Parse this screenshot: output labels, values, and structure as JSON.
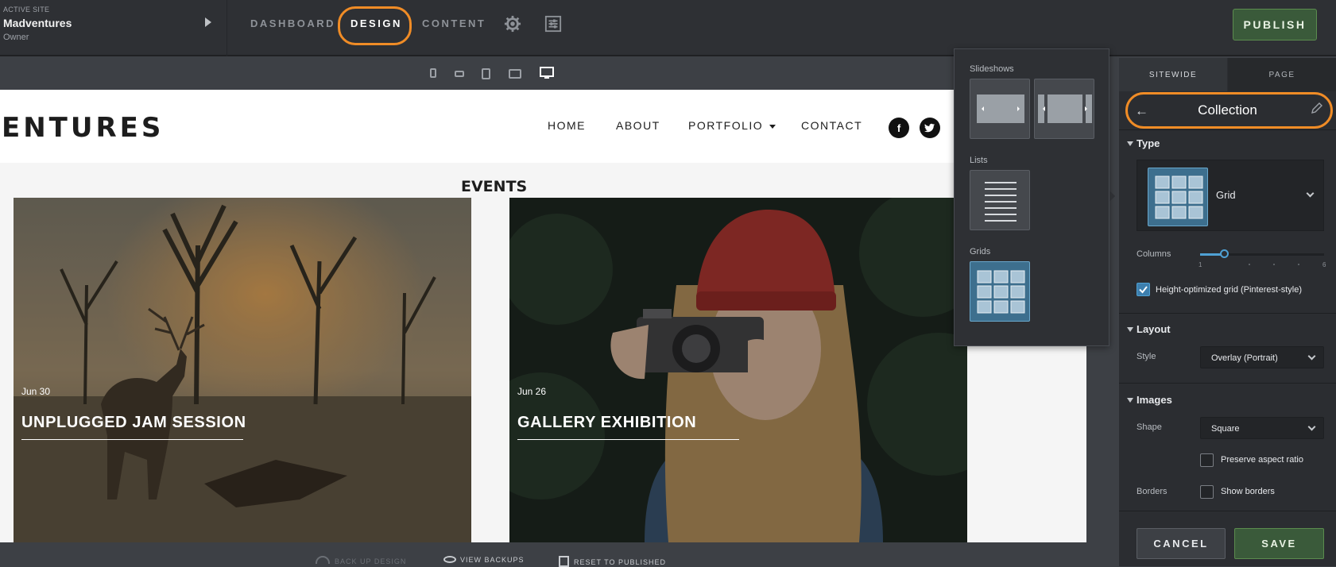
{
  "site": {
    "label": "ACTIVE SITE",
    "name": "Madventures",
    "role": "Owner"
  },
  "nav": {
    "tabs": [
      "DASHBOARD",
      "DESIGN",
      "CONTENT"
    ],
    "active": "DESIGN",
    "publish": "PUBLISH"
  },
  "icons": {
    "settings": "gear-icon",
    "panels": "sliders-icon"
  },
  "devices": [
    "phone-portrait",
    "phone-landscape",
    "tablet-portrait",
    "tablet-landscape",
    "desktop"
  ],
  "preview": {
    "logo_text": "ENTURES",
    "menu": [
      "HOME",
      "ABOUT",
      "PORTFOLIO",
      "CONTACT"
    ],
    "social": [
      "facebook",
      "twitter"
    ],
    "section_title": "EVENTS",
    "cards": [
      {
        "date": "Jun 30",
        "title": "UNPLUGGED JAM SESSION"
      },
      {
        "date": "Jun 26",
        "title": "GALLERY EXHIBITION"
      }
    ]
  },
  "popover": {
    "slideshows": "Slideshows",
    "lists": "Lists",
    "grids": "Grids"
  },
  "bottom": {
    "backup": "BACK UP DESIGN",
    "view": "VIEW BACKUPS",
    "reset": "RESET TO PUBLISHED"
  },
  "panel": {
    "tabs": {
      "sitewide": "SITEWIDE",
      "page": "PAGE"
    },
    "title": "Collection",
    "type": {
      "heading": "Type",
      "value": "Grid"
    },
    "columns": {
      "label": "Columns",
      "min": "1",
      "max": "6",
      "value": 2
    },
    "height_optimized": {
      "label": "Height-optimized grid (Pinterest-style)",
      "checked": true
    },
    "layout": {
      "heading": "Layout",
      "style_label": "Style",
      "style_value": "Overlay (Portrait)"
    },
    "images": {
      "heading": "Images",
      "shape_label": "Shape",
      "shape_value": "Square",
      "preserve": "Preserve aspect ratio",
      "borders_label": "Borders",
      "show_borders": "Show borders"
    },
    "cancel": "CANCEL",
    "save": "SAVE"
  },
  "colors": {
    "accent_orange": "#f08c26",
    "selection_blue": "#3d6f8e",
    "publish_green": "#3a5a3a"
  }
}
